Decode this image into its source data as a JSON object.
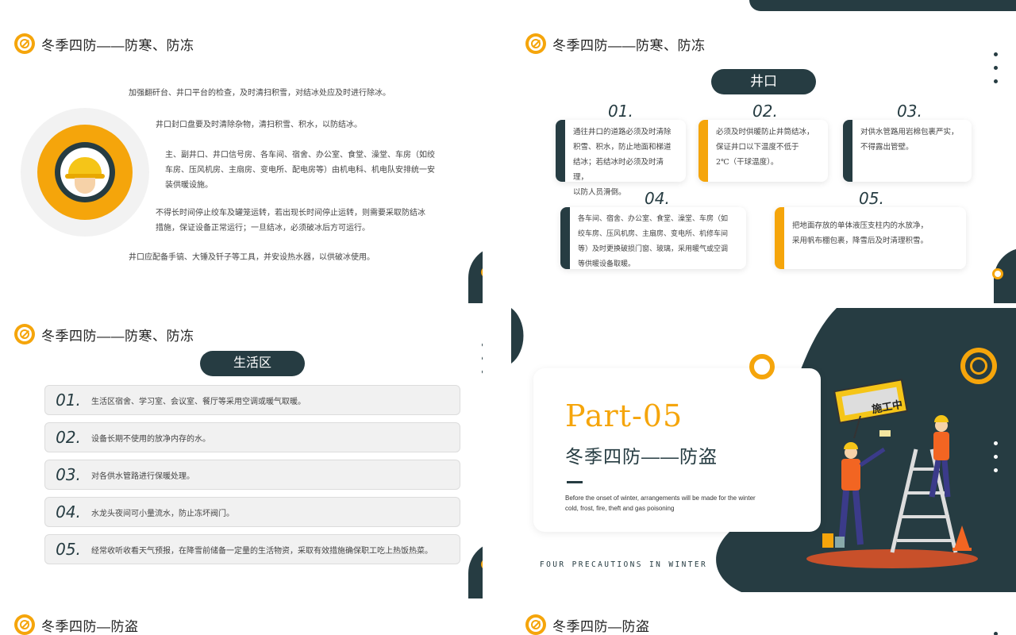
{
  "colors": {
    "dark": "#263c42",
    "accent": "#f5a50b",
    "bg": "#ffffff"
  },
  "slide1": {
    "title": "冬季四防——防寒、防冻",
    "icon": "no-fire-icon",
    "paragraphs": [
      "加强翻矸台、井口平台的检查，及时清扫积雪，对结冰处应及时进行除冰。",
      "井口封口盘要及时清除杂物，清扫积雪、积水，以防结冰。",
      "主、副井口、井口信号房、各车间、宿舍、办公室、食堂、澡堂、车房（如绞",
      "车房、压风机房、主扇房、变电所、配电房等）由机电科、机电队安排统一安",
      "装供暖设施。",
      "不得长时间停止绞车及罐笼运转，若出现长时间停止运转，则需要采取防结冰",
      "措施，保证设备正常运行；一旦结冰，必须破冰后方可运行。",
      "井口应配备手镐、大锤及钎子等工具，并安设热水器，以供破冰使用。"
    ]
  },
  "slide2": {
    "title": "冬季四防——防寒、防冻",
    "pill": "井口",
    "items": [
      {
        "num": "01.",
        "lines": [
          "通往井口的道路必须及时清除",
          "积雪、积水，防止地面和梯道",
          "结冰；若结冰时必须及时清理，",
          "以防人员滑倒。"
        ]
      },
      {
        "num": "02.",
        "lines": [
          "必须及时供暖防止井筒结冰，",
          "保证井口以下温度不低于",
          "2℃（干球温度）。"
        ]
      },
      {
        "num": "03.",
        "lines": [
          "对供水管路用岩棉包裹严实，",
          "不得露出管壁。"
        ]
      },
      {
        "num": "04.",
        "lines": [
          "各车间、宿舍、办公室、食堂、澡堂、车房（如",
          "绞车房、压风机房、主扇房、变电所、机修车间",
          "等）及时更换破损门窗、玻璃，采用暖气或空调",
          "等供暖设备取暖。"
        ]
      },
      {
        "num": "05.",
        "lines": [
          "把地面存放的单体液压支柱内的水放净，",
          "采用帆布棚包裹，降雪后及时清理积雪。"
        ]
      }
    ]
  },
  "slide3": {
    "title": "冬季四防——防寒、防冻",
    "pill": "生活区",
    "rows": [
      {
        "num": "01.",
        "text": "生活区宿舍、学习室、会议室、餐厅等采用空调或暖气取暖。"
      },
      {
        "num": "02.",
        "text": "设备长期不使用的放净内存的水。"
      },
      {
        "num": "03.",
        "text": "对各供水管路进行保暖处理。"
      },
      {
        "num": "04.",
        "text": "水龙头夜间可小量流水，防止冻坏阀门。"
      },
      {
        "num": "05.",
        "text": "经常收听收看天气预报，在降雪前储备一定量的生活物资，采取有效措施确保职工吃上热饭热菜。"
      }
    ]
  },
  "slide4": {
    "part": "Part-05",
    "title": "冬季四防——防盗",
    "subtitle": "Before the onset of winter, arrangements will be made for the winter cold, frost, fire, theft and gas poisoning",
    "footer": "FOUR PRECAUTIONS IN WINTER",
    "sign": "施工中"
  },
  "slide5": {
    "title": "冬季四防—防盗"
  },
  "slide6": {
    "title": "冬季四防—防盗"
  }
}
